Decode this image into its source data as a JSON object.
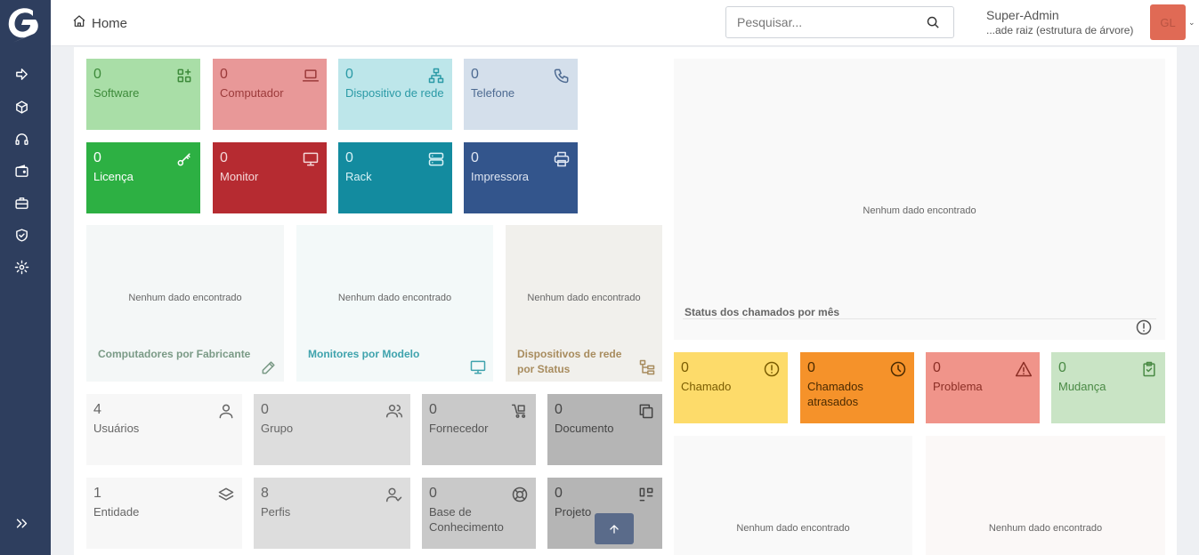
{
  "header": {
    "breadcrumb_home": "Home",
    "search_placeholder": "Pesquisar...",
    "user_name": "Super-Admin",
    "user_entity": "...ade raiz (estrutura de árvore)",
    "avatar_initials": "GL"
  },
  "sidebar": {
    "items": [
      {
        "icon": "arrow-right-icon"
      },
      {
        "icon": "box-icon"
      },
      {
        "icon": "headset-icon"
      },
      {
        "icon": "wallet-icon"
      },
      {
        "icon": "briefcase-icon"
      },
      {
        "icon": "shield-check-icon"
      },
      {
        "icon": "gear-icon"
      }
    ],
    "collapse_icon": "double-chevron-right-icon"
  },
  "assets": [
    {
      "count": "0",
      "label": "Software",
      "icon": "apps-plus-icon",
      "bg": "#a9dea7",
      "fg": "#3d8a3a"
    },
    {
      "count": "0",
      "label": "Computador",
      "icon": "laptop-icon",
      "bg": "#e89898",
      "fg": "#9b3a3a"
    },
    {
      "count": "0",
      "label": "Dispositivo de rede",
      "icon": "network-icon",
      "bg": "#bde6ea",
      "fg": "#2b9aa6"
    },
    {
      "count": "0",
      "label": "Telefone",
      "icon": "phone-icon",
      "bg": "#d4dfeb",
      "fg": "#4d6a91"
    },
    {
      "count": "0",
      "label": "Licença",
      "icon": "key-icon",
      "bg": "#2db043",
      "fg": "#ffffff"
    },
    {
      "count": "0",
      "label": "Monitor",
      "icon": "monitor-icon",
      "bg": "#b62b31",
      "fg": "#f4d7d8"
    },
    {
      "count": "0",
      "label": "Rack",
      "icon": "server-icon",
      "bg": "#138b9f",
      "fg": "#d8f2f6"
    },
    {
      "count": "0",
      "label": "Impressora",
      "icon": "printer-icon",
      "bg": "#33558c",
      "fg": "#dfe6f2"
    }
  ],
  "charts_mid": [
    {
      "empty": "Nenhum dado encontrado",
      "title": "Computadores por Fabricante",
      "icon": "edit-icon",
      "bg": "#f4f7f7",
      "fg": "#7a9a86"
    },
    {
      "empty": "Nenhum dado encontrado",
      "title": "Monitores por Modelo",
      "icon": "monitor-icon",
      "bg": "#f3f9f9",
      "fg": "#3fa3ad"
    },
    {
      "empty": "Nenhum dado encontrado",
      "title": "Dispositivos de rede por Status",
      "icon": "hierarchy-icon",
      "bg": "#f1f0ec",
      "fg": "#a88c5e"
    }
  ],
  "admin": [
    {
      "count": "4",
      "label": "Usuários",
      "icon": "user-icon",
      "bg": "#f7f7f7",
      "fg": "#666666"
    },
    {
      "count": "0",
      "label": "Grupo",
      "icon": "users-icon",
      "bg": "#dddddd",
      "fg": "#666666"
    },
    {
      "count": "0",
      "label": "Fornecedor",
      "icon": "cart-icon",
      "bg": "#c9c9c9",
      "fg": "#555555"
    },
    {
      "count": "0",
      "label": "Documento",
      "icon": "copy-icon",
      "bg": "#b5b5b5",
      "fg": "#444444"
    },
    {
      "count": "1",
      "label": "Entidade",
      "icon": "layers-icon",
      "bg": "#f7f7f7",
      "fg": "#666666"
    },
    {
      "count": "8",
      "label": "Perfis",
      "icon": "user-check-icon",
      "bg": "#dddddd",
      "fg": "#666666"
    },
    {
      "count": "0",
      "label": "Base de Conhecimento",
      "icon": "lifebuoy-icon",
      "bg": "#c9c9c9",
      "fg": "#555555"
    },
    {
      "count": "0",
      "label": "Projeto",
      "icon": "kanban-icon",
      "bg": "#b5b5b5",
      "fg": "#444444"
    }
  ],
  "right_panel": {
    "empty": "Nenhum dado encontrado",
    "title": "Status dos chamados por mês",
    "icon": "alert-circle-icon"
  },
  "tickets": [
    {
      "count": "0",
      "label": "Chamado",
      "icon": "alert-circle-icon",
      "bg": "#fddb6a",
      "fg": "#7a5c00"
    },
    {
      "count": "0",
      "label": "Chamados atrasados",
      "icon": "clock-icon",
      "bg": "#f5922a",
      "fg": "#4a2a00"
    },
    {
      "count": "0",
      "label": "Problema",
      "icon": "alert-triangle-icon",
      "bg": "#f0948a",
      "fg": "#8b2e25"
    },
    {
      "count": "0",
      "label": "Mudança",
      "icon": "clipboard-check-icon",
      "bg": "#c9e4c5",
      "fg": "#4a8a45"
    }
  ],
  "bottom_charts": [
    {
      "empty": "Nenhum dado encontrado",
      "bg": "#f9f9f9"
    },
    {
      "empty": "Nenhum dado encontrado",
      "bg": "#fbf8f7"
    }
  ],
  "scroll_top_icon": "arrow-up-icon"
}
